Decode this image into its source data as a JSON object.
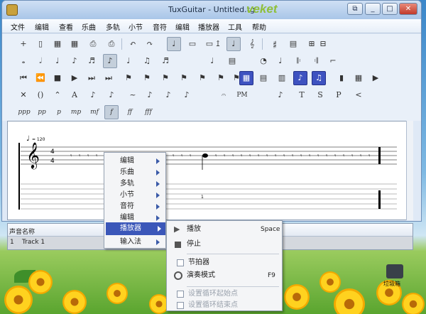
{
  "window": {
    "title": "TuxGuitar - Untitled.tg",
    "brand": "veket",
    "buttons": {
      "restore": "⧉",
      "minimize": "_",
      "maximize": "□",
      "close": "✕"
    }
  },
  "menubar": [
    "文件",
    "编辑",
    "查看",
    "乐曲",
    "多轨",
    "小节",
    "音符",
    "编辑",
    "播放器",
    "工具",
    "帮助"
  ],
  "toolbar": {
    "row1": [
      "+",
      "▯",
      "▦",
      "▦",
      "⎙",
      "⎙",
      "↶",
      "↷",
      "♩",
      "▭",
      "▭",
      "↥",
      "♩",
      "𝄞",
      "𝄰",
      "▤",
      "⊞",
      "⊟"
    ],
    "row2": [
      "𝅝",
      "𝅗𝅥",
      "♩",
      "♪",
      "♬",
      "♪",
      "♩",
      "♫",
      "♬",
      "♩",
      "▤",
      "◔",
      "♩",
      "𝄆",
      "𝄇",
      "⌐"
    ],
    "row3": [
      "⏮",
      "⏪",
      "■",
      "▶",
      "⏭",
      "⏭",
      "⚑",
      "⚑",
      "⚑",
      "⚑",
      "⚑",
      "⚑",
      "⚑",
      "▦",
      "▤",
      "▥",
      "♪",
      "♫",
      "▮",
      "▦",
      "▶"
    ],
    "row4": [
      "✕",
      "()",
      "⌃",
      "A",
      "♪",
      "♪",
      "~",
      "♪",
      "♪",
      "♪",
      "𝄐",
      "PM",
      "♪",
      "T",
      "S",
      "P",
      "<"
    ],
    "row5": [
      "ppp",
      "pp",
      "p",
      "mp",
      "mf",
      "f",
      "ff",
      "fff"
    ]
  },
  "score": {
    "tempo": "= 120",
    "time_signature": {
      "top": "4",
      "bottom": "4"
    },
    "tab_fret": "1"
  },
  "track_table": {
    "headers": [
      "声音",
      "名称"
    ],
    "rows": [
      {
        "index": "1",
        "name": "Track 1"
      }
    ]
  },
  "context_menu": {
    "items": [
      "编辑",
      "乐曲",
      "多轨",
      "小节",
      "音符",
      "编辑",
      "播放器",
      "输入法"
    ],
    "selected": "播放器"
  },
  "submenu": {
    "play": {
      "label": "播放",
      "shortcut": "Space"
    },
    "stop": {
      "label": "停止"
    },
    "metronome": {
      "label": "节拍器"
    },
    "practice": {
      "label": "演奏模式",
      "shortcut": "F9"
    },
    "loop_start": {
      "label": "设置循环起始点"
    },
    "loop_end": {
      "label": "设置循环结束点"
    }
  },
  "desktop": {
    "recycle_label": "垃圾箱"
  }
}
